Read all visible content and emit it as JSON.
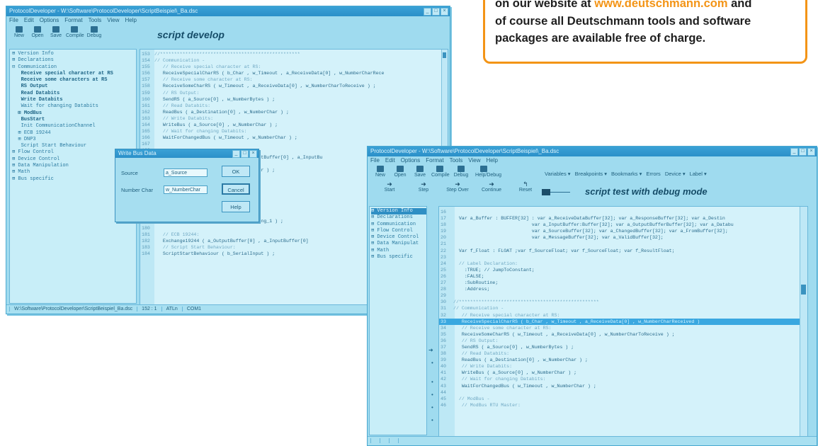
{
  "callout": {
    "line1_before": "on our website at ",
    "line1_link": "www.deutschmann.com",
    "line1_after": " and",
    "line2": "of course all Deutschmann tools and software",
    "line3": "packages are available free of charge."
  },
  "left_window": {
    "title": "ProtocolDeveloper - W:\\Software\\ProtocolDeveloper\\ScriptBeispiel\\_Ba.dsc",
    "menu": [
      "File",
      "Edit",
      "Options",
      "Format",
      "Tools",
      "View",
      "Help"
    ],
    "toolbar": [
      "New",
      "Open",
      "Save",
      "Compile",
      "Debug"
    ],
    "script_label": "script develop",
    "tree": [
      {
        "t": "⊞ Version Info",
        "b": false
      },
      {
        "t": "⊞ Declarations",
        "b": false
      },
      {
        "t": "⊟ Communication",
        "b": false
      },
      {
        "t": "   Receive special character at RS",
        "b": true
      },
      {
        "t": "   Receive some characters at RS",
        "b": true
      },
      {
        "t": "   RS Output",
        "b": true
      },
      {
        "t": "   Read Databits",
        "b": true
      },
      {
        "t": "   Write Databits",
        "b": true
      },
      {
        "t": "   Wait for changing Databits",
        "b": false
      },
      {
        "t": "  ⊞ ModBus",
        "b": true
      },
      {
        "t": "   BusStart",
        "b": true
      },
      {
        "t": "   Init CommunicationChannel",
        "b": false
      },
      {
        "t": "  ⊞ ECB 19244",
        "b": false
      },
      {
        "t": "  ⊞ DNP3",
        "b": false
      },
      {
        "t": "   Script Start Behaviour",
        "b": false
      },
      {
        "t": "⊞ Flow Control",
        "b": false
      },
      {
        "t": "⊞ Device Control",
        "b": false
      },
      {
        "t": "⊞ Data Manipulation",
        "b": false
      },
      {
        "t": "⊞ Math",
        "b": false
      },
      {
        "t": "⊞ Bus specific",
        "b": false
      }
    ],
    "code": [
      {
        "n": "153",
        "t": "//**************************************************",
        "c": true
      },
      {
        "n": "154",
        "t": "// Communication -",
        "c": true
      },
      {
        "n": "155",
        "t": "   // Receive special character at RS:",
        "c": true
      },
      {
        "n": "156",
        "t": "   ReceiveSpecialCharRS ( b_Char , w_Timeout , a_ReceiveData[0] , w_NumberCharRece",
        "c": false
      },
      {
        "n": "157",
        "t": "   // Receive some character at RS:",
        "c": true
      },
      {
        "n": "158",
        "t": "   ReceiveSomeCharRS ( w_Timeout , a_ReceiveData[0] , w_NumberCharToReceive ) ;",
        "c": false
      },
      {
        "n": "159",
        "t": "   // RS Output:",
        "c": true
      },
      {
        "n": "160",
        "t": "   SendRS ( a_Source[0] , w_NumberBytes ) ;",
        "c": false
      },
      {
        "n": "161",
        "t": "   // Read Databits:",
        "c": true
      },
      {
        "n": "162",
        "t": "   ReadBus ( a_Destination[0] , w_NumberChar ) ;",
        "c": false
      },
      {
        "n": "163",
        "t": "   // Write Databits:",
        "c": true
      },
      {
        "n": "164",
        "t": "   WriteBus ( a_Source[0] , w_NumberChar ) ;",
        "c": false
      },
      {
        "n": "165",
        "t": "   // Wait for changing Databits:",
        "c": true
      },
      {
        "n": "166",
        "t": "   WaitForChangedBus ( w_Timeout , w_NumberChar ) ;",
        "c": false
      },
      {
        "n": "167",
        "t": "",
        "c": false
      },
      {
        "n": "168",
        "t": "",
        "c": false
      },
      {
        "n": "169",
        "t": "                             ( a_OutputBuffer[0] , a_InputBu",
        "c": false
      },
      {
        "n": "170",
        "t": "",
        "c": false
      },
      {
        "n": "171",
        "t": "                             ( a_Number ) ;",
        "c": false
      },
      {
        "n": "172",
        "t": "",
        "c": false
      },
      {
        "n": "173",
        "t": "                             a[0] ) ;",
        "c": false
      },
      {
        "n": "174",
        "t": "",
        "c": false
      },
      {
        "n": "175",
        "t": "",
        "c": false
      },
      {
        "n": "176",
        "t": "   // BusStart:",
        "c": true
      },
      {
        "n": "177",
        "t": "   BusStart ;",
        "c": false
      },
      {
        "n": "178",
        "t": "   // Init CommunicationChannel:",
        "c": true
      },
      {
        "n": "179",
        "t": "   InitCommunicationChannel ( 1 , 1_Song_1 ) ;",
        "c": false
      },
      {
        "n": "180",
        "t": "",
        "c": false
      },
      {
        "n": "181",
        "t": "   // ECB 19244:",
        "c": true
      },
      {
        "n": "182",
        "t": "   Exchange19244 ( a_OutputBuffer[0] , a_InputBuffer[0]",
        "c": false
      },
      {
        "n": "183",
        "t": "   // Script Start Behaviour:",
        "c": true
      },
      {
        "n": "184",
        "t": "   ScriptStartBehaviour ( b_SerialInput ) ;",
        "c": false
      }
    ],
    "status": [
      "W:\\Software\\ProtocolDeveloper\\ScriptBeispiel_Ba.dsc",
      "152 : 1",
      "ATLn",
      "COM1"
    ]
  },
  "dialog": {
    "title": "Write Bus Data",
    "source_label": "Source",
    "source_value": "a_Source",
    "number_label": "Number Char",
    "number_value": "w_NumberChar",
    "ok": "OK",
    "cancel": "Cancel",
    "help": "Help"
  },
  "right_window": {
    "title": "ProtocolDeveloper - W:\\Software\\ProtocolDeveloper\\ScriptBeispiel\\_Ba.dsc",
    "menu": [
      "File",
      "Edit",
      "Options",
      "Format",
      "Tools",
      "View",
      "Help"
    ],
    "toolbar": [
      "New",
      "Open",
      "Save",
      "Compile",
      "Debug",
      "Help/Debug"
    ],
    "dropdowns": [
      "Variables ▾",
      "Breakpoints ▾",
      "Bookmarks ▾",
      "Errors",
      "Device ▾",
      "Label ▾"
    ],
    "debug_toolbar": [
      "Start",
      "Step",
      "Step Over",
      "Continue",
      "Reset"
    ],
    "script_label": "script test with debug mode",
    "tree": [
      {
        "t": "⊞ Version Info",
        "b": false
      },
      {
        "t": "⊞ Declarations",
        "b": false
      },
      {
        "t": "⊞ Communication",
        "b": false
      },
      {
        "t": "⊞ Flow Control",
        "b": false
      },
      {
        "t": "⊞ Device Control",
        "b": false
      },
      {
        "t": "⊞ Data Manipulat",
        "b": false
      },
      {
        "t": "⊞ Math",
        "b": false
      },
      {
        "t": "⊞ Bus specific",
        "b": false
      }
    ],
    "code": [
      {
        "n": "16",
        "t": "",
        "c": false,
        "h": false
      },
      {
        "n": "17",
        "t": "  Var a_Buffer : BUFFER[32] : var a_ReceiveDataBuffer[32]; var a_ResponseBuffer[32]; var a_Destin",
        "c": false,
        "h": false
      },
      {
        "n": "18",
        "t": "                            var a_InputBuffer:Buffer[32]; var a_OutputBufferBuffer[32]; var a_Databu",
        "c": false,
        "h": false
      },
      {
        "n": "19",
        "t": "                            var a_SourceBuffer[32]; var a_ChangedBuffer[32]; var a_FromBuffer[32];",
        "c": false,
        "h": false
      },
      {
        "n": "20",
        "t": "                            var a_MessageBuffer[32]; var a_ValidBuffer[32];",
        "c": false,
        "h": false
      },
      {
        "n": "21",
        "t": "",
        "c": false,
        "h": false
      },
      {
        "n": "22",
        "t": "  Var f_Float : FLOAT ;var f_SourceFloat; var f_SourceFloat; var f_ResultFloat;",
        "c": false,
        "h": false
      },
      {
        "n": "23",
        "t": "",
        "c": false,
        "h": false
      },
      {
        "n": "24",
        "t": "  // Label Declaration:",
        "c": true,
        "h": false
      },
      {
        "n": "25",
        "t": "    :TRUE; // JumpToConstant;",
        "c": false,
        "h": false
      },
      {
        "n": "26",
        "t": "    :FALSE;",
        "c": false,
        "h": false
      },
      {
        "n": "27",
        "t": "    :SubRoutine;",
        "c": false,
        "h": false
      },
      {
        "n": "28",
        "t": "    :Address;",
        "c": false,
        "h": false
      },
      {
        "n": "29",
        "t": "",
        "c": false,
        "h": false
      },
      {
        "n": "30",
        "t": "//**************************************************",
        "c": true,
        "h": false
      },
      {
        "n": "31",
        "t": "// Communication -",
        "c": true,
        "h": false
      },
      {
        "n": "32",
        "t": "   // Receive special character at RS:",
        "c": true,
        "h": false
      },
      {
        "n": "33",
        "t": "   ReceiveSpecialCharRS ( b_Char , w_Timeout , a_ReceiveData[0] , w_NumberCharReceived )",
        "c": false,
        "h": true
      },
      {
        "n": "34",
        "t": "   // Receive some character at RS:",
        "c": true,
        "h": false
      },
      {
        "n": "35",
        "t": "   ReceiveSomeCharRS ( w_Timeout , a_ReceiveData[0] , w_NumberCharToReceive ) ;",
        "c": false,
        "h": false
      },
      {
        "n": "36",
        "t": "   // RS Output:",
        "c": true,
        "h": false
      },
      {
        "n": "37",
        "t": "   SendRS ( a_Source[0] , w_NumberBytes ) ;",
        "c": false,
        "h": false
      },
      {
        "n": "38",
        "t": "   // Read Databits:",
        "c": true,
        "h": false
      },
      {
        "n": "39",
        "t": "   ReadBus ( a_Destination[0] , w_NumberChar ) ;",
        "c": false,
        "h": false
      },
      {
        "n": "40",
        "t": "   // Write Databits:",
        "c": true,
        "h": false
      },
      {
        "n": "41",
        "t": "   WriteBus ( a_Source[0] , w_NumberChar ) ;",
        "c": false,
        "h": false
      },
      {
        "n": "42",
        "t": "   // Wait for changing Databits:",
        "c": true,
        "h": false
      },
      {
        "n": "43",
        "t": "   WaitForChangedBus ( w_Timeout , w_NumberChar ) ;",
        "c": false,
        "h": false
      },
      {
        "n": "44",
        "t": "",
        "c": false,
        "h": false
      },
      {
        "n": "45",
        "t": "  // ModBus -",
        "c": true,
        "h": false
      },
      {
        "n": "46",
        "t": "   // ModBus RTU Master:",
        "c": true,
        "h": false
      }
    ],
    "status": [
      "",
      "",
      "",
      ""
    ]
  }
}
